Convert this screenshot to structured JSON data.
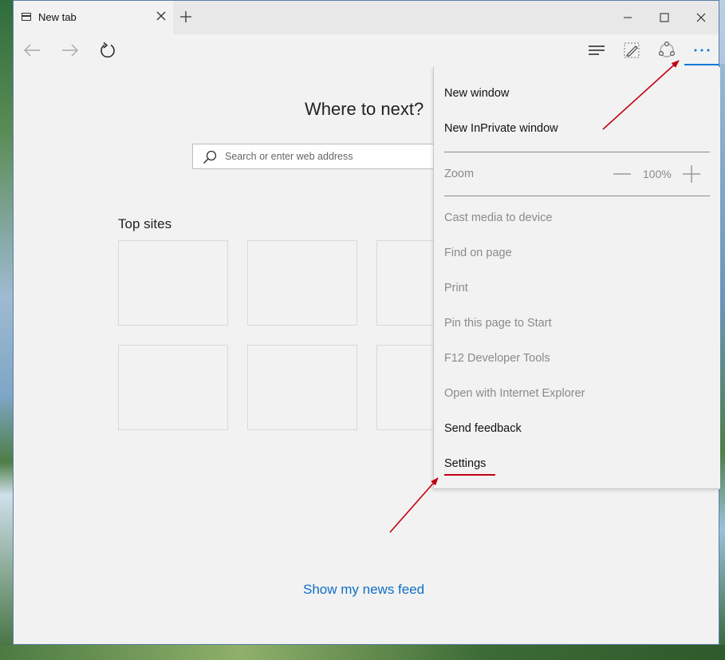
{
  "tab": {
    "title": "New tab"
  },
  "page": {
    "headline": "Where to next?",
    "search_placeholder": "Search or enter web address",
    "top_sites_label": "Top sites",
    "news_feed_link": "Show my news feed"
  },
  "menu": {
    "new_window": "New window",
    "new_inprivate": "New InPrivate window",
    "zoom_label": "Zoom",
    "zoom_value": "100%",
    "cast": "Cast media to device",
    "find": "Find on page",
    "print": "Print",
    "pin": "Pin this page to Start",
    "devtools": "F12 Developer Tools",
    "open_ie": "Open with Internet Explorer",
    "feedback": "Send feedback",
    "settings": "Settings"
  },
  "colors": {
    "accent": "#0078d7",
    "link": "#0f6fc6",
    "annotation": "#c0000f",
    "disabled_text": "#8a8a8a"
  },
  "icons": [
    "tab-page-icon",
    "close-icon",
    "plus-icon",
    "minimize-icon",
    "maximize-icon",
    "back-icon",
    "forward-icon",
    "refresh-icon",
    "hub-icon",
    "web-note-icon",
    "share-icon",
    "more-icon",
    "search-icon"
  ]
}
